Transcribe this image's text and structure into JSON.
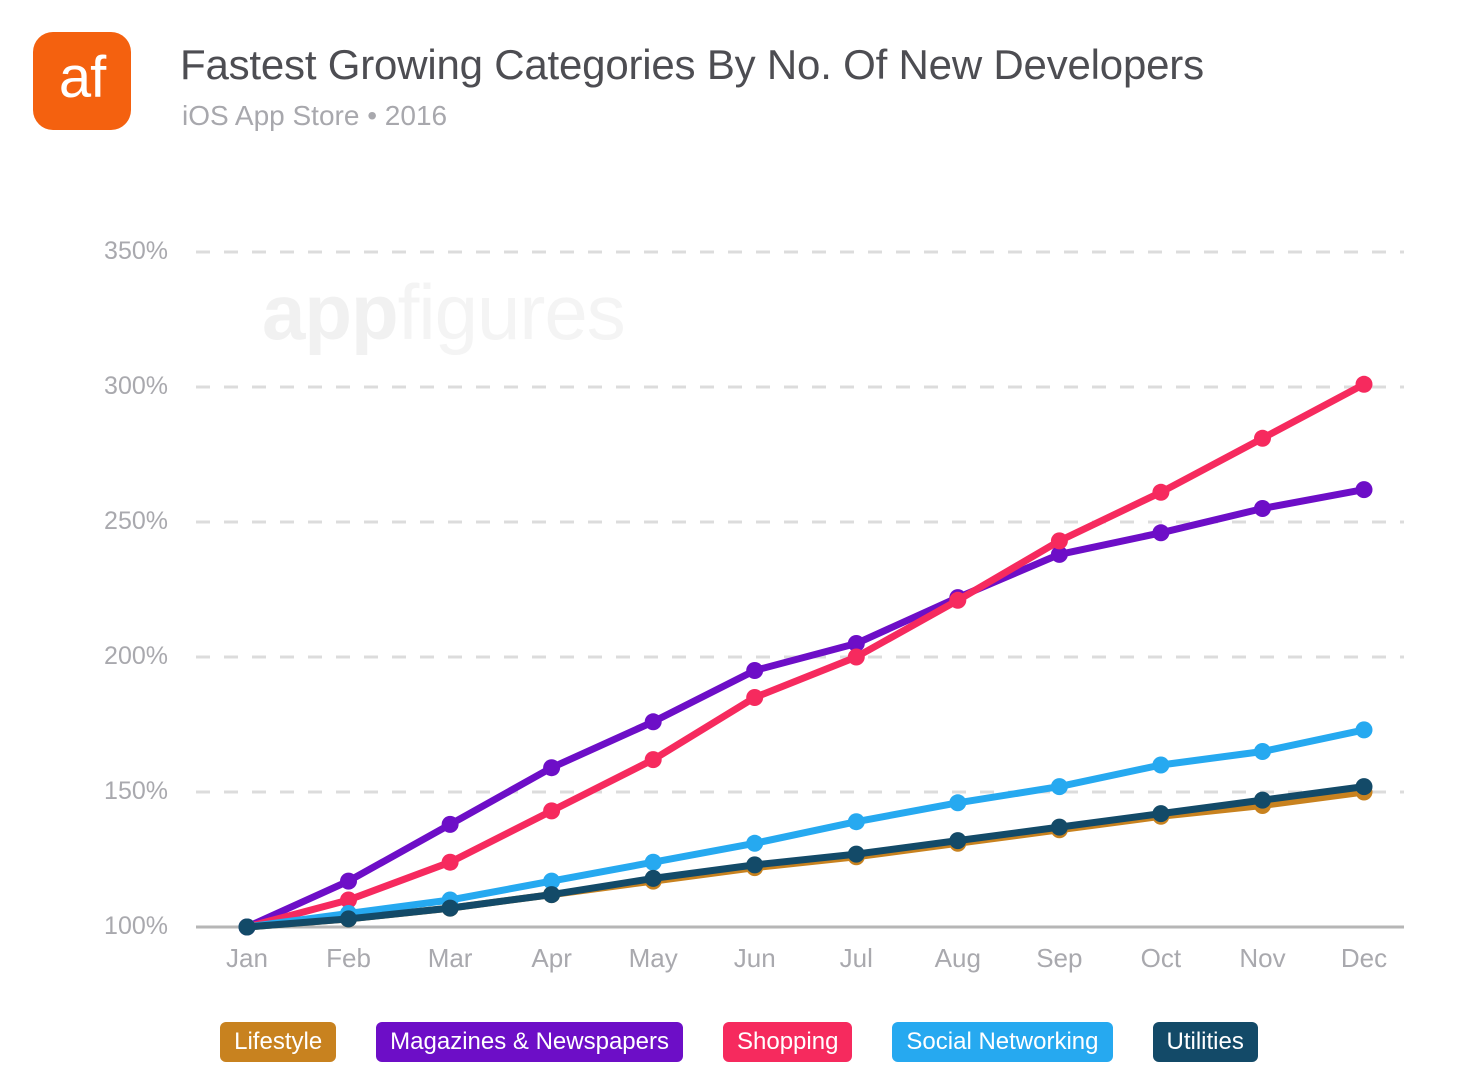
{
  "brand": {
    "logo_text": "af",
    "logo_color": "#f4610f",
    "watermark_bold": "app",
    "watermark_light": "figures"
  },
  "header": {
    "title": "Fastest Growing Categories By No. Of New Developers",
    "subtitle": "iOS App Store • 2016"
  },
  "chart_data": {
    "type": "line",
    "title": "Fastest Growing Categories By No. Of New Developers",
    "subtitle": "iOS App Store • 2016",
    "xlabel": "",
    "ylabel": "",
    "ylim": [
      100,
      350
    ],
    "yticks": [
      100,
      150,
      200,
      250,
      300,
      350
    ],
    "ytick_labels": [
      "100%",
      "150%",
      "200%",
      "250%",
      "300%",
      "350%"
    ],
    "grid": true,
    "legend_position": "bottom",
    "x": [
      "Jan",
      "Feb",
      "Mar",
      "Apr",
      "May",
      "Jun",
      "Jul",
      "Aug",
      "Sep",
      "Oct",
      "Nov",
      "Dec"
    ],
    "categories": [
      "Jan",
      "Feb",
      "Mar",
      "Apr",
      "May",
      "Jun",
      "Jul",
      "Aug",
      "Sep",
      "Oct",
      "Nov",
      "Dec"
    ],
    "series": [
      {
        "name": "Lifestyle",
        "color": "#c8821f",
        "values": [
          100,
          103,
          107,
          112,
          117,
          122,
          126,
          131,
          136,
          141,
          145,
          150
        ]
      },
      {
        "name": "Magazines & Newspapers",
        "color": "#6d0ec7",
        "values": [
          100,
          117,
          138,
          159,
          176,
          195,
          205,
          222,
          238,
          246,
          255,
          262
        ]
      },
      {
        "name": "Shopping",
        "color": "#f62a5e",
        "values": [
          100,
          110,
          124,
          143,
          162,
          185,
          200,
          221,
          243,
          261,
          281,
          301
        ]
      },
      {
        "name": "Social Networking",
        "color": "#26a9f0",
        "values": [
          100,
          105,
          110,
          117,
          124,
          131,
          139,
          146,
          152,
          160,
          165,
          173
        ]
      },
      {
        "name": "Utilities",
        "color": "#134a68",
        "values": [
          100,
          103,
          107,
          112,
          118,
          123,
          127,
          132,
          137,
          142,
          147,
          152
        ]
      }
    ]
  }
}
